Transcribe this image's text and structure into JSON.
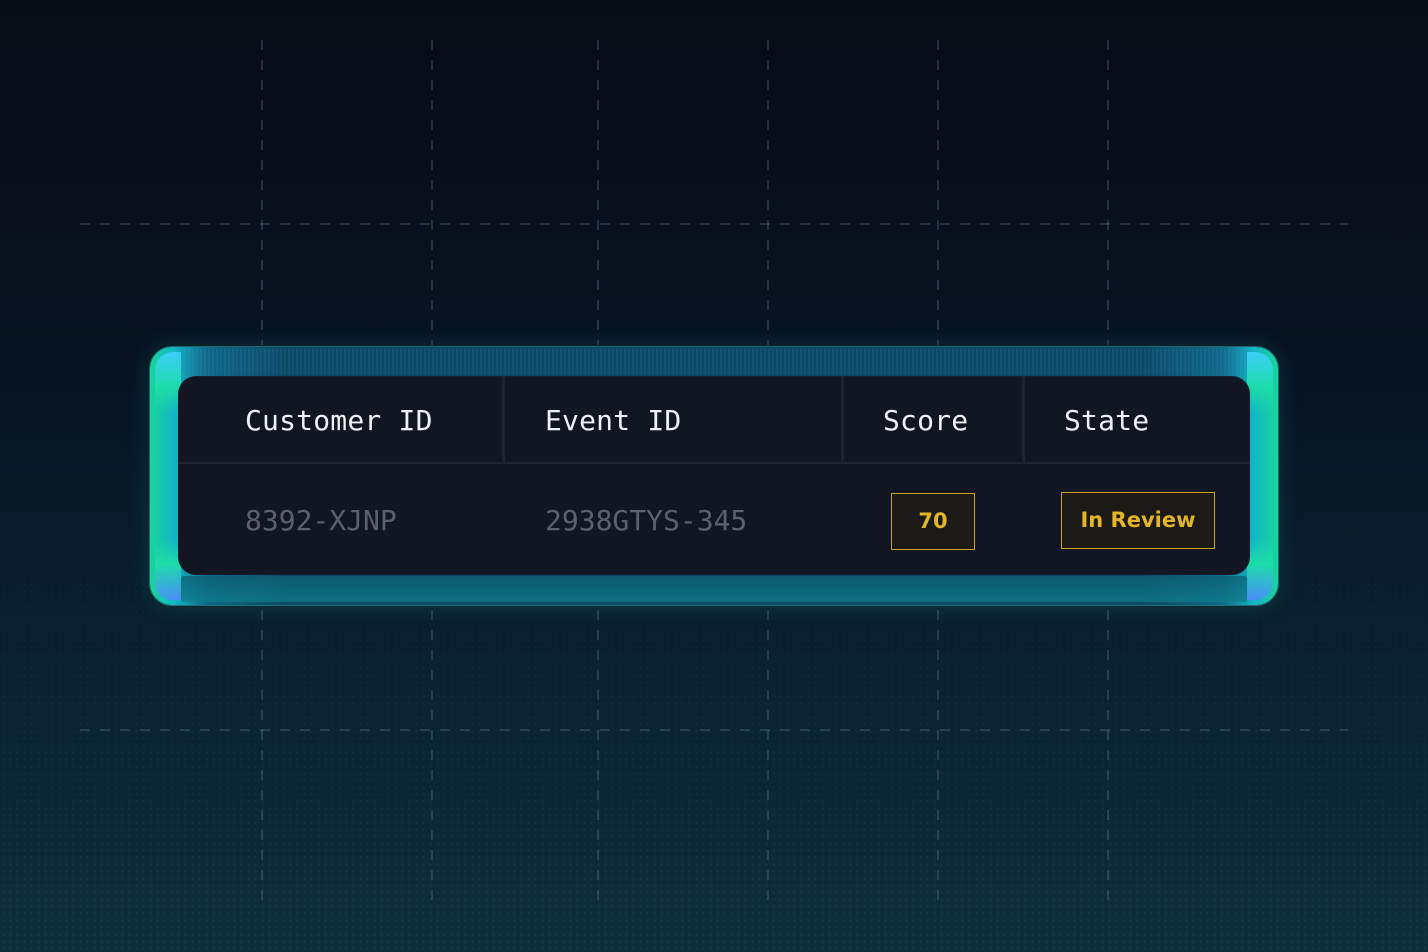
{
  "table": {
    "headers": {
      "customer_id": "Customer ID",
      "event_id": "Event ID",
      "score": "Score",
      "state": "State"
    },
    "rows": [
      {
        "customer_id": "8392-XJNP",
        "event_id": "2938GTYS-345",
        "score": "70",
        "state": "In Review"
      }
    ]
  },
  "colors": {
    "background": "#081422",
    "card": "#121622",
    "frame_accent": "#18d69a",
    "badge_accent": "#e2b52a"
  }
}
